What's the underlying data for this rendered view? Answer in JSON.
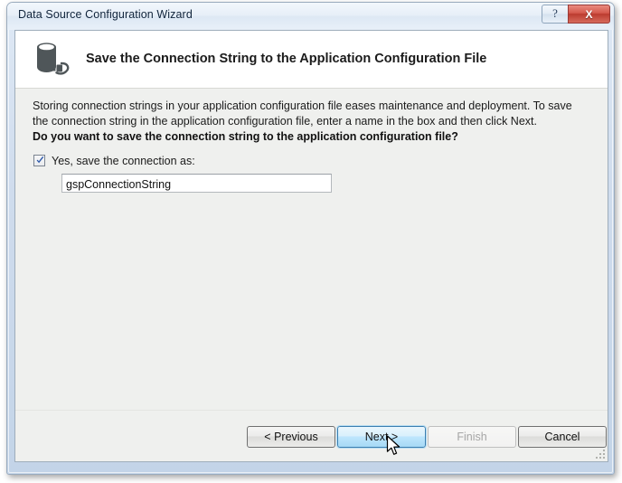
{
  "window": {
    "title": "Data Source Configuration Wizard",
    "caption_buttons": [
      {
        "name": "help",
        "label": "?"
      },
      {
        "name": "close",
        "label": "X"
      }
    ]
  },
  "header": {
    "icon": "database-connection-icon",
    "title": "Save the Connection String to the Application Configuration File"
  },
  "body": {
    "intro_text": "Storing connection strings in your application configuration file eases maintenance and deployment. To save the connection string in the application configuration file, enter a name in the box and then click Next.",
    "question_text": "Do you want to save the connection string to the application configuration file?",
    "checkbox": {
      "label": "Yes, save the connection as:",
      "checked": true
    },
    "connection_name_input": {
      "value": "gspConnectionString",
      "placeholder": ""
    }
  },
  "buttons": {
    "previous": {
      "label": "< Previous",
      "enabled": true
    },
    "next": {
      "label": "Next >",
      "enabled": true,
      "state": "hover"
    },
    "finish": {
      "label": "Finish",
      "enabled": false
    },
    "cancel": {
      "label": "Cancel",
      "enabled": true
    }
  },
  "colors": {
    "accent_blue": "#3c7fb1",
    "close_red": "#bb3b2f",
    "client_bg": "#eff0ee",
    "header_bg": "#ffffff",
    "icon_gray": "#4f5659",
    "check_blue": "#2a56a8",
    "disabled_text": "#a6a6a6"
  }
}
